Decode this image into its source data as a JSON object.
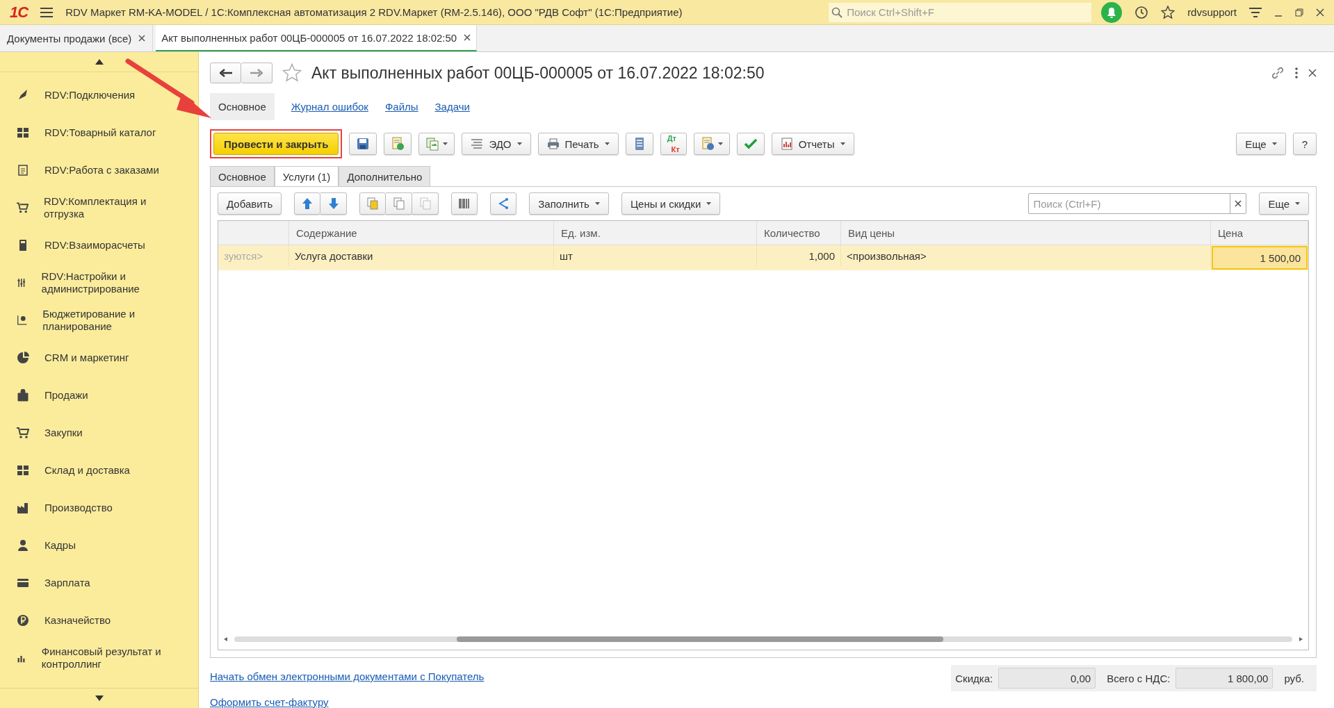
{
  "app_bar": {
    "logo": "1С",
    "title": "RDV Маркет RM-KA-MODEL / 1С:Комплексная автоматизация 2 RDV.Маркет (RM-2.5.146), ООО \"РДВ Софт\"  (1С:Предприятие)",
    "search": {
      "placeholder": "Поиск Ctrl+Shift+F"
    },
    "user": "rdvsupport"
  },
  "tabs": [
    {
      "label": "Документы продажи (все)",
      "selected": false
    },
    {
      "label": "Акт выполненных работ 00ЦБ-000005 от 16.07.2022 18:02:50",
      "selected": true
    }
  ],
  "sidebar": {
    "items": [
      {
        "label": "RDV:Подключения"
      },
      {
        "label": "RDV:Товарный каталог"
      },
      {
        "label": "RDV:Работа с заказами"
      },
      {
        "label": "RDV:Комплектация и отгрузка"
      },
      {
        "label": "RDV:Взаиморасчеты"
      },
      {
        "label": "RDV:Настройки и администрирование"
      },
      {
        "label": "Бюджетирование и планирование"
      },
      {
        "label": "CRM и маркетинг"
      },
      {
        "label": "Продажи"
      },
      {
        "label": "Закупки"
      },
      {
        "label": "Склад и доставка"
      },
      {
        "label": "Производство"
      },
      {
        "label": "Кадры"
      },
      {
        "label": "Зарплата"
      },
      {
        "label": "Казначейство"
      },
      {
        "label": "Финансовый результат и контроллинг"
      }
    ]
  },
  "form": {
    "title": "Акт выполненных работ 00ЦБ-000005 от 16.07.2022 18:02:50",
    "favorite": false,
    "sections": [
      {
        "label": "Основное",
        "selected": true
      },
      {
        "label": "Журнал ошибок",
        "selected": false
      },
      {
        "label": "Файлы",
        "selected": false
      },
      {
        "label": "Задачи",
        "selected": false
      }
    ],
    "command_bar": {
      "groups": [
        [
          {
            "kind": "primary",
            "label": "Провести и закрыть",
            "highlighted": true
          }
        ],
        [
          {
            "kind": "icon",
            "dropdown": false
          }
        ],
        [
          {
            "kind": "icon",
            "dropdown": false
          }
        ],
        [
          {
            "kind": "icon",
            "dropdown": true
          }
        ],
        [
          {
            "kind": "text",
            "label": "ЭДО",
            "dropdown": true
          }
        ],
        [
          {
            "kind": "text",
            "label": "Печать",
            "dropdown": true
          }
        ],
        [
          {
            "kind": "icon",
            "dropdown": false
          }
        ],
        [
          {
            "kind": "dtkt",
            "top": "Дт",
            "bottom": "Кт"
          }
        ],
        [
          {
            "kind": "icon",
            "dropdown": true
          }
        ],
        [
          {
            "kind": "icon",
            "dropdown": false
          }
        ],
        [
          {
            "kind": "text",
            "label": "Отчеты",
            "dropdown": true
          }
        ]
      ],
      "right": [
        {
          "kind": "text",
          "label": "Еще",
          "dropdown": true
        },
        {
          "kind": "text",
          "label": "?",
          "dropdown": false
        }
      ]
    },
    "pages": [
      {
        "label": "Основное",
        "selected": false
      },
      {
        "label": "Услуги (1)",
        "selected": true
      },
      {
        "label": "Дополнительно",
        "selected": false
      }
    ],
    "table_bar": {
      "groups": [
        [
          {
            "kind": "text",
            "label": "Добавить",
            "dropdown": false,
            "disabled": false
          }
        ],
        [
          {
            "kind": "icon",
            "dropdown": false,
            "disabled": false
          },
          {
            "kind": "icon",
            "dropdown": false,
            "disabled": false
          }
        ],
        [
          {
            "kind": "icon",
            "dropdown": false,
            "disabled": false
          },
          {
            "kind": "icon",
            "dropdown": false,
            "disabled": false
          },
          {
            "kind": "icon",
            "dropdown": false,
            "disabled": true
          }
        ],
        [
          {
            "kind": "icon",
            "dropdown": false,
            "disabled": false
          }
        ],
        [
          {
            "kind": "icon",
            "dropdown": false,
            "disabled": false
          }
        ],
        [
          {
            "kind": "text",
            "label": "Заполнить",
            "dropdown": true,
            "disabled": false
          }
        ],
        [
          {
            "kind": "text",
            "label": "Цены и скидки",
            "dropdown": true,
            "disabled": false
          }
        ]
      ],
      "search": {
        "placeholder": "Поиск (Ctrl+F)"
      },
      "more": "Еще"
    },
    "table": {
      "columns": [
        "",
        "Содержание",
        "Ед. изм.",
        "Количество",
        "Вид цены",
        "Цена"
      ],
      "rows": [
        {
          "selected": true,
          "cells": [
            {
              "text": "зуются>",
              "current": false
            },
            {
              "text": "Услуга доставки",
              "current": false
            },
            {
              "text": "шт",
              "current": false
            },
            {
              "text": "1,000",
              "current": false
            },
            {
              "text": "<произвольная>",
              "current": false
            },
            {
              "text": "1 500,00",
              "current": true
            }
          ]
        }
      ]
    },
    "links": [
      "Начать обмен электронными документами с Покупатель",
      "Оформить счет-фактуру"
    ],
    "totals": {
      "discount_label": "Скидка:",
      "discount": "0,00",
      "total_label": "Всего с НДС:",
      "total": "1 800,00",
      "currency": "руб."
    }
  },
  "annotation": {
    "kind": "arrow"
  }
}
